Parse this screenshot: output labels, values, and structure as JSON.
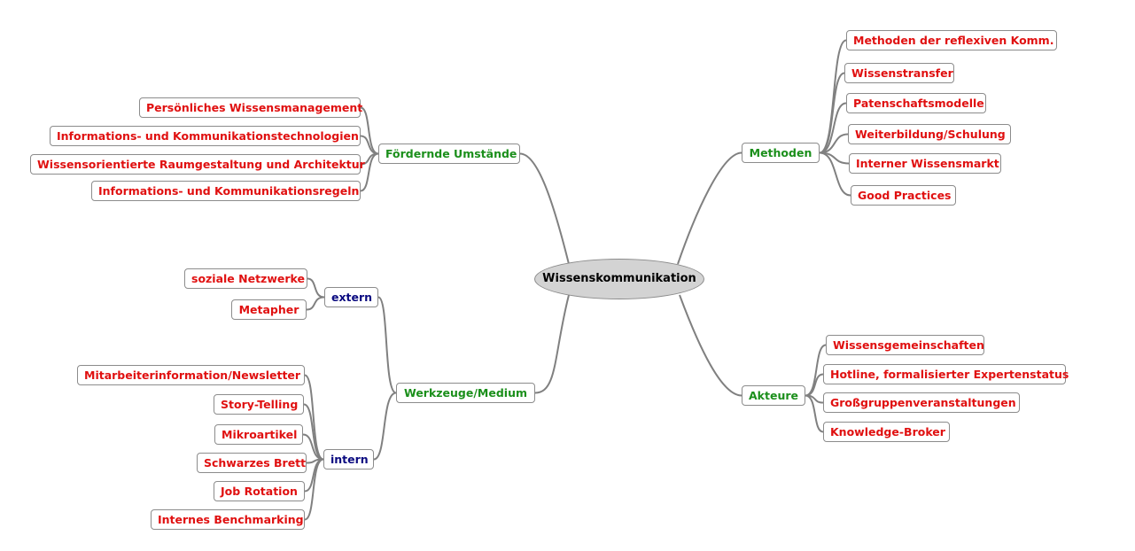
{
  "colors": {
    "leaf": "#e01010",
    "main": "#1b8f1b",
    "sub": "#0a0a80",
    "center_fill": "#d3d3d3",
    "line": "#808080"
  },
  "center": {
    "label": "Wissenskommunikation"
  },
  "branches": {
    "foerdernde": {
      "label": "Fördernde Umstände",
      "children": [
        "Persönliches Wissensmanagement",
        "Informations- und Kommunikationstechnologien",
        "Wissensorientierte Raumgestaltung und Architektur",
        "Informations- und Kommunikationsregeln"
      ]
    },
    "methoden": {
      "label": "Methoden",
      "children": [
        "Methoden der reflexiven Komm.",
        "Wissenstransfer",
        "Patenschaftsmodelle",
        "Weiterbildung/Schulung",
        "Interner Wissensmarkt",
        "Good Practices"
      ]
    },
    "werkzeuge": {
      "label": "Werkzeuge/Medium",
      "extern": {
        "label": "extern",
        "children": [
          "soziale Netzwerke",
          "Metapher"
        ]
      },
      "intern": {
        "label": "intern",
        "children": [
          "Mitarbeiterinformation/Newsletter",
          "Story-Telling",
          "Mikroartikel",
          "Schwarzes Brett",
          "Job Rotation",
          "Internes Benchmarking"
        ]
      }
    },
    "akteure": {
      "label": "Akteure",
      "children": [
        "Wissensgemeinschaften",
        "Hotline, formalisierter Expertenstatus",
        "Großgruppenveranstaltungen",
        "Knowledge-Broker"
      ]
    }
  }
}
